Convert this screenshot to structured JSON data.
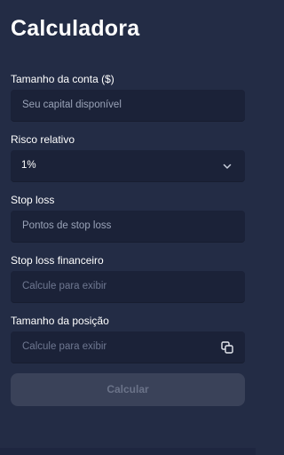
{
  "header": {
    "title": "Calculadora"
  },
  "form": {
    "account_size": {
      "label": "Tamanho da conta ($)",
      "placeholder": "Seu capital disponível"
    },
    "risk": {
      "label": "Risco relativo",
      "value": "1%"
    },
    "stop_loss": {
      "label": "Stop loss",
      "placeholder": "Pontos de stop loss"
    },
    "stop_loss_financial": {
      "label": "Stop loss financeiro",
      "placeholder": "Calcule para exibir"
    },
    "position_size": {
      "label": "Tamanho da posição",
      "placeholder": "Calcule para exibir"
    }
  },
  "actions": {
    "calculate_label": "Calcular"
  },
  "icons": {
    "select": "chevron-down-icon",
    "copy": "copy-icon"
  },
  "colors": {
    "background": "#232c45",
    "field": "#1b2238",
    "button_disabled": "#3a4259"
  }
}
